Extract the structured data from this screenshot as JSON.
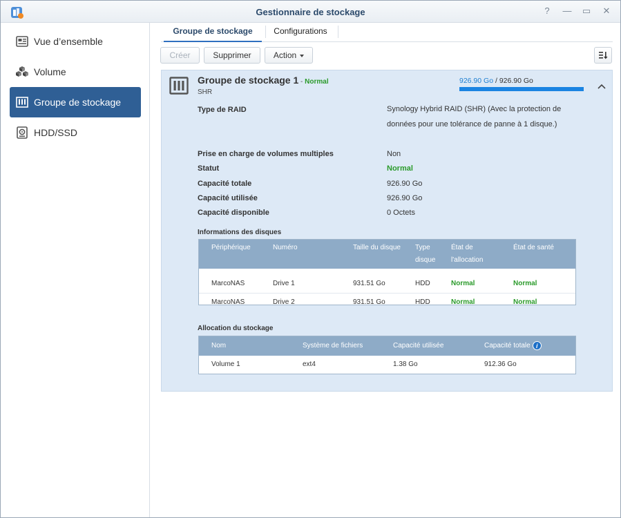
{
  "window": {
    "title": "Gestionnaire de stockage",
    "controls": {
      "help": "?",
      "minimize": "—",
      "maximize": "▭",
      "close": "✕"
    }
  },
  "sidebar": {
    "items": [
      {
        "label": "Vue d’ensemble",
        "icon": "overview-icon",
        "active": false
      },
      {
        "label": "Volume",
        "icon": "volume-cubes-icon",
        "active": false
      },
      {
        "label": "Groupe de stockage",
        "icon": "storage-pool-icon",
        "active": true
      },
      {
        "label": "HDD/SSD",
        "icon": "hdd-icon",
        "active": false
      }
    ]
  },
  "tabs": [
    {
      "label": "Groupe de stockage",
      "active": true
    },
    {
      "label": "Configurations",
      "active": false
    }
  ],
  "toolbar": {
    "create_label": "Créer",
    "delete_label": "Supprimer",
    "action_label": "Action"
  },
  "pool": {
    "title": "Groupe de stockage 1",
    "separator": " - ",
    "status": "Normal",
    "subtitle": "SHR",
    "usage_used": "926.90 Go",
    "usage_sep": " / ",
    "usage_total": "926.90 Go",
    "usage_fraction": 1.0,
    "properties": [
      {
        "label": "Type de RAID",
        "value": "Synology Hybrid RAID (SHR) (Avec la protection de données pour une tolérance de panne à 1 disque.)"
      },
      {
        "label": "Prise en charge de volumes multiples",
        "value": "Non"
      },
      {
        "label": "Statut",
        "value": "Normal"
      },
      {
        "label": "Capacité totale",
        "value": "926.90 Go"
      },
      {
        "label": "Capacité utilisée",
        "value": "926.90 Go"
      },
      {
        "label": "Capacité disponible",
        "value": "0 Octets"
      }
    ]
  },
  "disks": {
    "title": "Informations des disques",
    "columns": [
      "Périphérique",
      "Numéro",
      "Taille du disque",
      "Type\ndisque",
      "État de\nl'allocation",
      "État de santé"
    ],
    "rows": [
      [
        "MarcoNAS",
        "Drive 1",
        "931.51 Go",
        "HDD",
        "Normal",
        "Normal"
      ],
      [
        "MarcoNAS",
        "Drive 2",
        "931.51 Go",
        "HDD",
        "Normal",
        "Normal"
      ]
    ]
  },
  "allocation": {
    "title": "Allocation du stockage",
    "columns": [
      "Nom",
      "Système de fichiers",
      "Capacité utilisée",
      "Capacité totale"
    ],
    "rows": [
      [
        "Volume 1",
        "ext4",
        "1.38 Go",
        "912.36 Go"
      ]
    ]
  },
  "colors": {
    "accent": "#2f5f95",
    "ok": "#2a9a2a",
    "panel": "#dde9f6",
    "grid_header": "#8eabc7",
    "usage_bar": "#1b84e2"
  }
}
